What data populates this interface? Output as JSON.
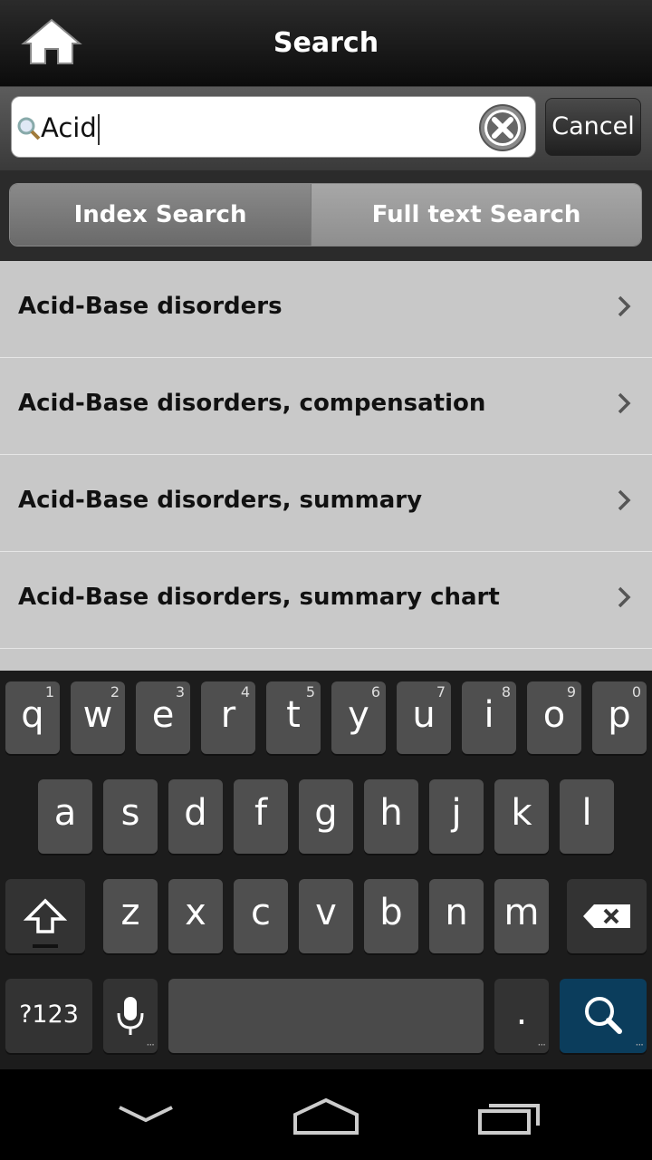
{
  "header": {
    "title": "Search",
    "home_icon": "home-icon"
  },
  "search": {
    "value": "Acid",
    "cancel_label": "Cancel"
  },
  "segments": {
    "index_label": "Index Search",
    "full_label": "Full text Search"
  },
  "results": [
    {
      "label": "Acid-Base disorders"
    },
    {
      "label": "Acid-Base disorders, compensation"
    },
    {
      "label": "Acid-Base disorders, summary"
    },
    {
      "label": "Acid-Base disorders, summary chart"
    }
  ],
  "keyboard": {
    "row1": [
      {
        "k": "q",
        "n": "1"
      },
      {
        "k": "w",
        "n": "2"
      },
      {
        "k": "e",
        "n": "3"
      },
      {
        "k": "r",
        "n": "4"
      },
      {
        "k": "t",
        "n": "5"
      },
      {
        "k": "y",
        "n": "6"
      },
      {
        "k": "u",
        "n": "7"
      },
      {
        "k": "i",
        "n": "8"
      },
      {
        "k": "o",
        "n": "9"
      },
      {
        "k": "p",
        "n": "0"
      }
    ],
    "row2": [
      "a",
      "s",
      "d",
      "f",
      "g",
      "h",
      "j",
      "k",
      "l"
    ],
    "row3": [
      "z",
      "x",
      "c",
      "v",
      "b",
      "n",
      "m"
    ],
    "symbols_label": "?123",
    "period_label": "."
  },
  "colors": {
    "search_key": "#0b3d5c",
    "list_bg": "#c9c9c9"
  }
}
